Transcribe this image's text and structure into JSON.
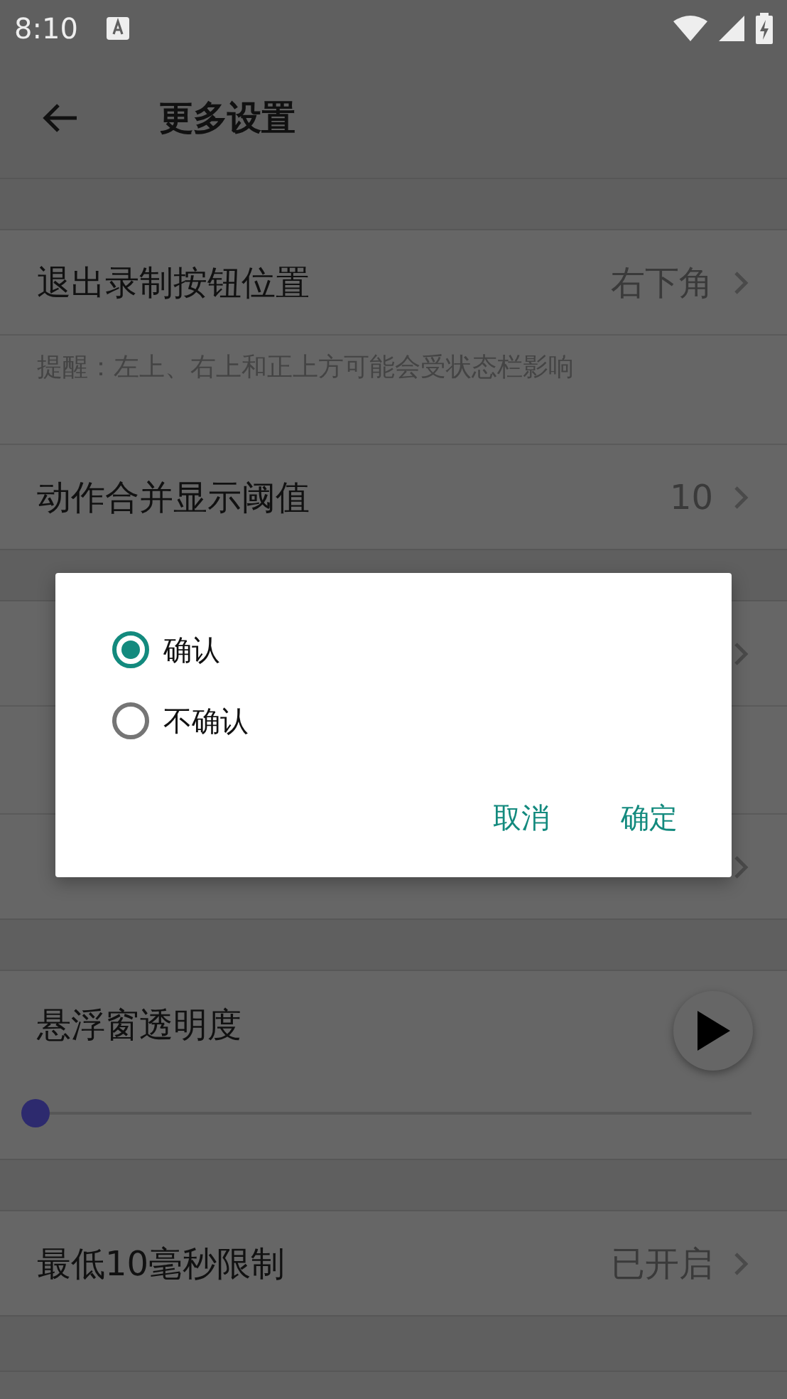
{
  "status_bar": {
    "time": "8:10"
  },
  "toolbar": {
    "title": "更多设置"
  },
  "groups": [
    {
      "items": [
        {
          "kind": "row",
          "title": "退出录制按钮位置",
          "value": "右下角"
        },
        {
          "kind": "hint",
          "text": "提醒：左上、右上和正上方可能会受状态栏影响"
        },
        {
          "kind": "row",
          "title": "动作合并显示阈值",
          "value": "10"
        }
      ]
    },
    {
      "items": [
        {
          "kind": "row"
        },
        {
          "kind": "blank"
        },
        {
          "kind": "row"
        }
      ]
    },
    {
      "items": [
        {
          "kind": "slider",
          "title": "悬浮窗透明度",
          "level": 0
        }
      ]
    },
    {
      "items": [
        {
          "kind": "row",
          "title": "最低10毫秒限制",
          "value": "已开启"
        }
      ]
    }
  ],
  "dialog": {
    "options": [
      {
        "label": "确认",
        "selected": true
      },
      {
        "label": "不确认",
        "selected": false
      }
    ],
    "buttons": [
      "取消",
      "确定"
    ]
  }
}
